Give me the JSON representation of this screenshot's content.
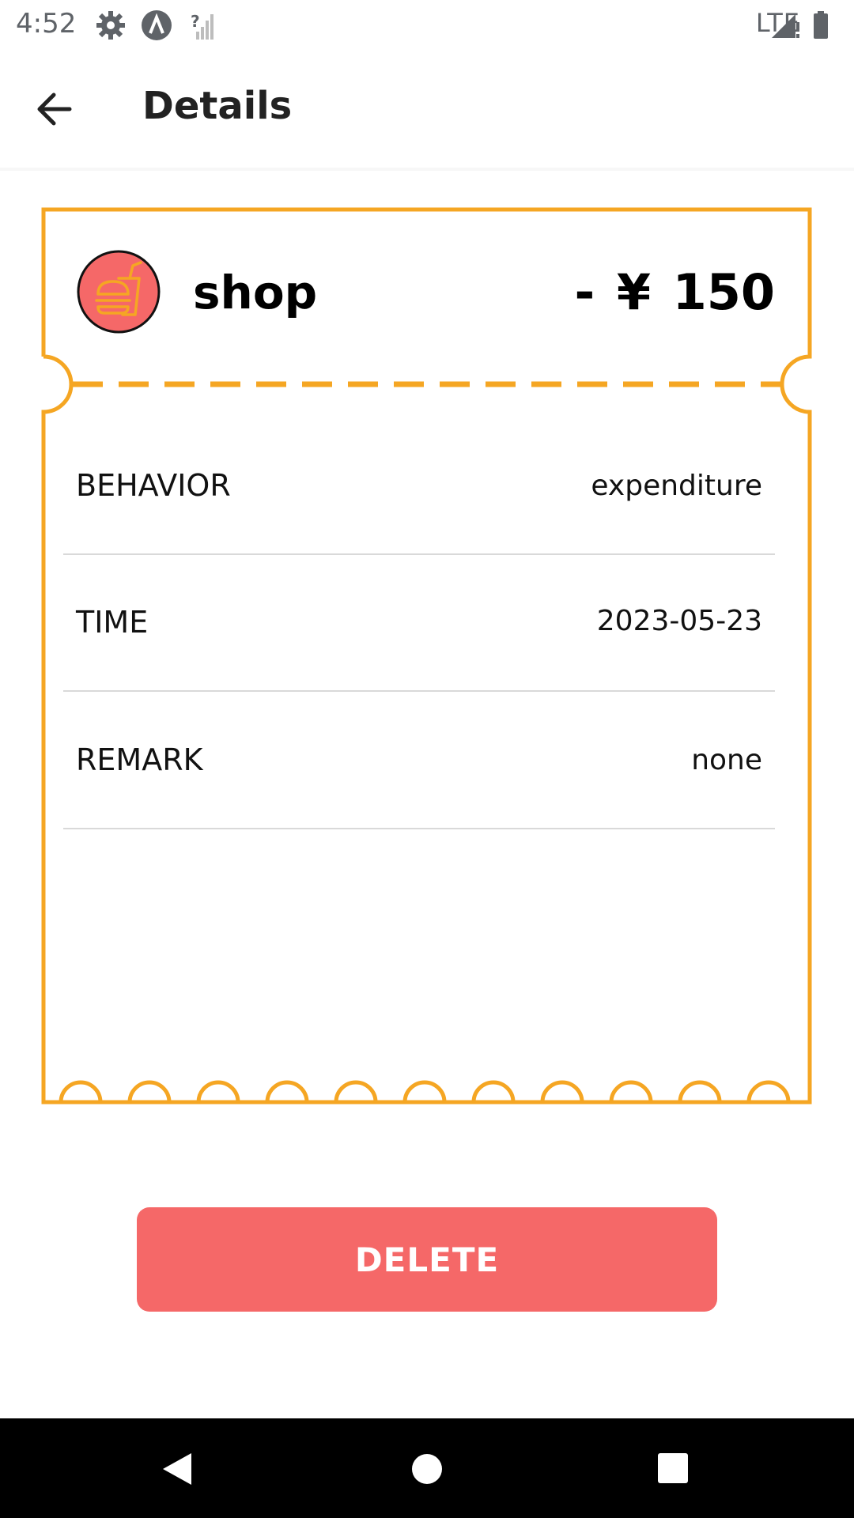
{
  "status_bar": {
    "time": "4:52",
    "network": "LTE",
    "icons": [
      "gear-icon",
      "app-a-icon",
      "no-signal-icon",
      "cell-signal-icon",
      "battery-icon"
    ]
  },
  "app_bar": {
    "title": "Details",
    "back_icon": "arrow-left-icon"
  },
  "record": {
    "category_icon": "fast-food-icon",
    "category": "shop",
    "amount": "- ¥ 150",
    "accent_color": "#F5A623",
    "icon_bg_color": "#F56868",
    "rows": [
      {
        "label": "BEHAVIOR",
        "value": "expenditure"
      },
      {
        "label": "TIME",
        "value": "2023-05-23"
      },
      {
        "label": "REMARK",
        "value": "none"
      }
    ]
  },
  "actions": {
    "delete_label": "DELETE",
    "delete_color": "#F56868"
  },
  "nav_bar": {
    "icons": [
      "back-triangle-icon",
      "home-circle-icon",
      "recents-square-icon"
    ]
  }
}
